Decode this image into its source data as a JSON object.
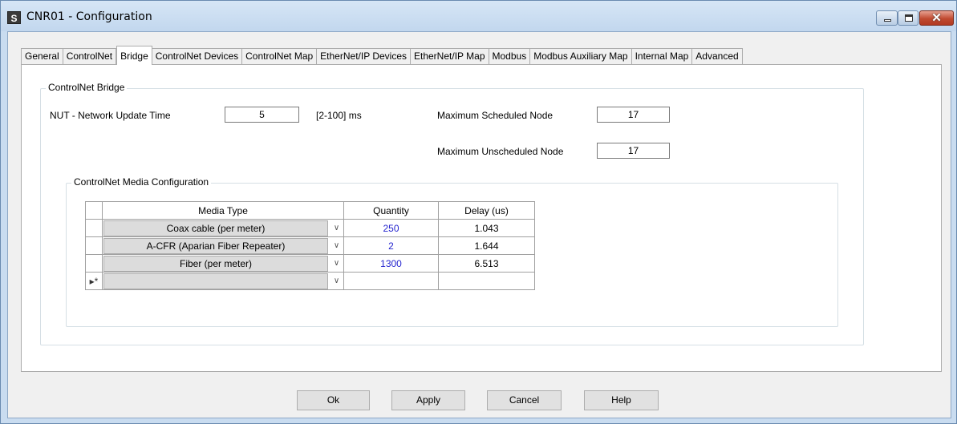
{
  "window": {
    "app_icon": "S",
    "title": "CNR01 - Configuration",
    "controls": {
      "minimize": "minimize-icon",
      "maximize": "maximize-icon",
      "close": "close-icon"
    },
    "close_glyph": "✕"
  },
  "tabs": [
    {
      "label": "General"
    },
    {
      "label": "ControlNet"
    },
    {
      "label": "Bridge",
      "active": true
    },
    {
      "label": "ControlNet Devices"
    },
    {
      "label": "ControlNet Map"
    },
    {
      "label": "EtherNet/IP Devices"
    },
    {
      "label": "EtherNet/IP Map"
    },
    {
      "label": "Modbus"
    },
    {
      "label": "Modbus Auxiliary Map"
    },
    {
      "label": "Internal Map"
    },
    {
      "label": "Advanced"
    }
  ],
  "bridge": {
    "group_title": "ControlNet Bridge",
    "nut_label": "NUT - Network Update Time",
    "nut_value": "5",
    "nut_range": "[2-100] ms",
    "max_sched_label": "Maximum Scheduled Node",
    "max_sched_value": "17",
    "max_unsched_label": "Maximum Unscheduled Node",
    "max_unsched_value": "17"
  },
  "media": {
    "group_title": "ControlNet Media Configuration",
    "columns": [
      "Media Type",
      "Quantity",
      "Delay (us)"
    ],
    "rows": [
      {
        "media_type": "Coax cable (per meter)",
        "quantity": "250",
        "delay": "1.043"
      },
      {
        "media_type": "A-CFR (Aparian Fiber Repeater)",
        "quantity": "2",
        "delay": "1.644"
      },
      {
        "media_type": "Fiber (per meter)",
        "quantity": "1300",
        "delay": "6.513"
      }
    ],
    "new_row_marker": "▸*",
    "dropdown_glyph": "∨"
  },
  "buttons": {
    "ok": "Ok",
    "apply": "Apply",
    "cancel": "Cancel",
    "help": "Help"
  }
}
